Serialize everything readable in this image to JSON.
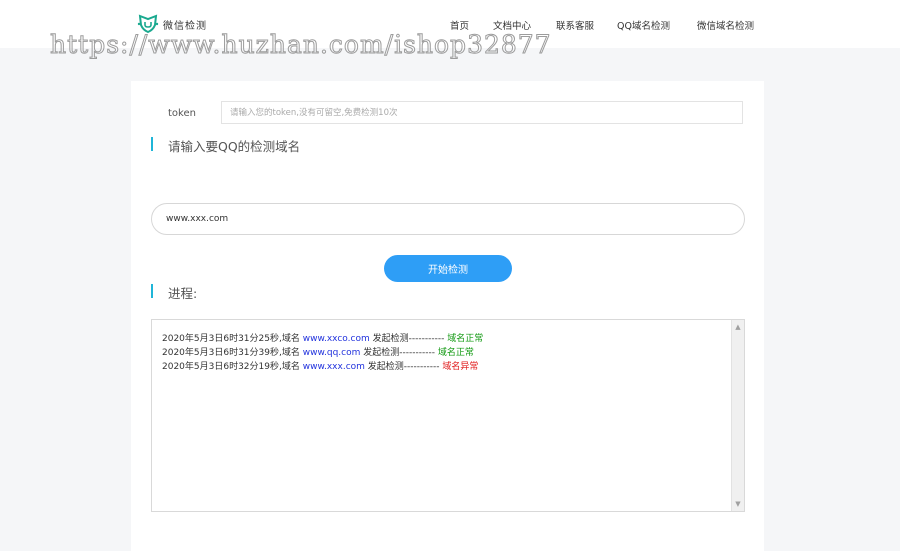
{
  "header": {
    "logo_text": "微信检测",
    "nav": [
      {
        "label": "首页"
      },
      {
        "label": "文档中心"
      },
      {
        "label": "联系客服"
      },
      {
        "label": "QQ域名检测"
      },
      {
        "label": "微信域名检测"
      }
    ]
  },
  "watermark": "https://www.huzhan.com/ishop32877",
  "form": {
    "token_label": "token",
    "token_placeholder": "请输入您的token,没有可留空,免费检测10次",
    "section_title": "请输入要QQ的检测域名",
    "domain_value": "www.xxx.com",
    "start_button": "开始检测"
  },
  "progress": {
    "title": "进程:",
    "lines": [
      {
        "prefix": "2020年5月3日6时31分25秒,域名",
        "domain": "www.xxco.com",
        "middle": "发起检测-----------",
        "result": "域名正常",
        "status": "ok"
      },
      {
        "prefix": "2020年5月3日6时31分39秒,域名",
        "domain": "www.qq.com",
        "middle": "发起检测-----------",
        "result": "域名正常",
        "status": "ok"
      },
      {
        "prefix": "2020年5月3日6时32分19秒,域名",
        "domain": "www.xxx.com",
        "middle": "发起检测-----------",
        "result": "域名异常",
        "status": "bad"
      }
    ]
  },
  "colors": {
    "accent": "#2e9ef6",
    "section_bar": "#1fb5d8",
    "logo": "#1aa98f",
    "domain_link": "#2233dd",
    "ok": "#119911",
    "bad": "#e01818"
  },
  "icons": {
    "logo": "shield-logo-icon",
    "scroll_up": "scroll-up-arrow-icon",
    "scroll_down": "scroll-down-arrow-icon"
  }
}
